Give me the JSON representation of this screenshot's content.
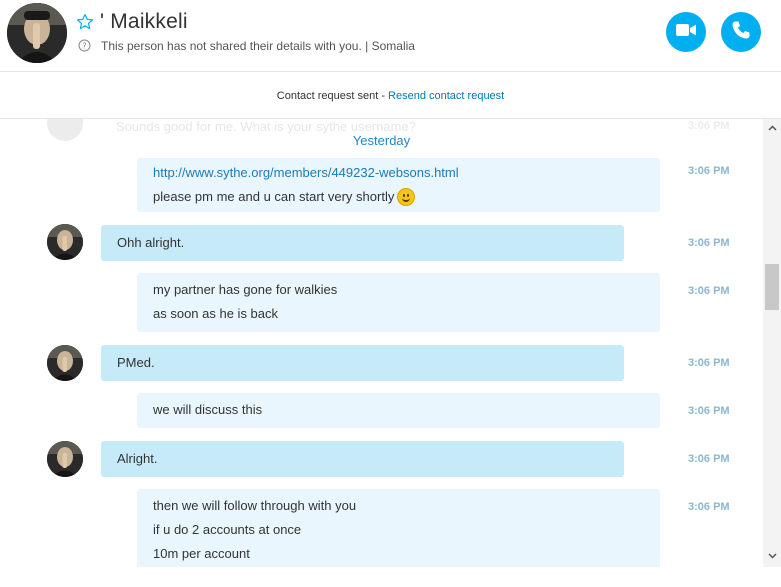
{
  "header": {
    "contact_name": "' Maikkeli",
    "subtitle": "This person has not shared their details with you.  |  Somalia",
    "favorite_icon": "star-outline-icon",
    "video_call_icon": "video-camera-icon",
    "audio_call_icon": "phone-icon"
  },
  "request_bar": {
    "text": "Contact request sent - ",
    "resend_link": "Resend contact request"
  },
  "conversation": {
    "faded_message": "Sounds good for me. What is your sythe username?",
    "faded_time": "3:06 PM",
    "date_separator": "Yesterday",
    "messages": [
      {
        "direction": "out",
        "lines": [
          "http://www.sythe.org/members/449232-websons.html",
          "please pm me and u can start very shortly"
        ],
        "emoji": "smiley",
        "time": "3:06 PM"
      },
      {
        "direction": "in",
        "lines": [
          "Ohh alright."
        ],
        "time": "3:06 PM"
      },
      {
        "direction": "out",
        "lines": [
          "my partner has gone for walkies",
          "as soon as he is back"
        ],
        "time": "3:06 PM"
      },
      {
        "direction": "in",
        "lines": [
          "PMed."
        ],
        "time": "3:06 PM"
      },
      {
        "direction": "out",
        "lines": [
          "we will discuss this"
        ],
        "time": "3:06 PM"
      },
      {
        "direction": "in",
        "lines": [
          "Alright."
        ],
        "time": "3:06 PM"
      },
      {
        "direction": "out",
        "lines": [
          "then we will follow through with you",
          "if u do 2 accounts at once",
          "10m per account"
        ],
        "time": "3:06 PM"
      }
    ]
  },
  "colors": {
    "accent": "#00aff0",
    "link": "#1a7bb9",
    "outgoing_bubble": "#e9f6fd",
    "incoming_bubble": "#c7eaf9",
    "timestamp": "#8bb7cf"
  }
}
